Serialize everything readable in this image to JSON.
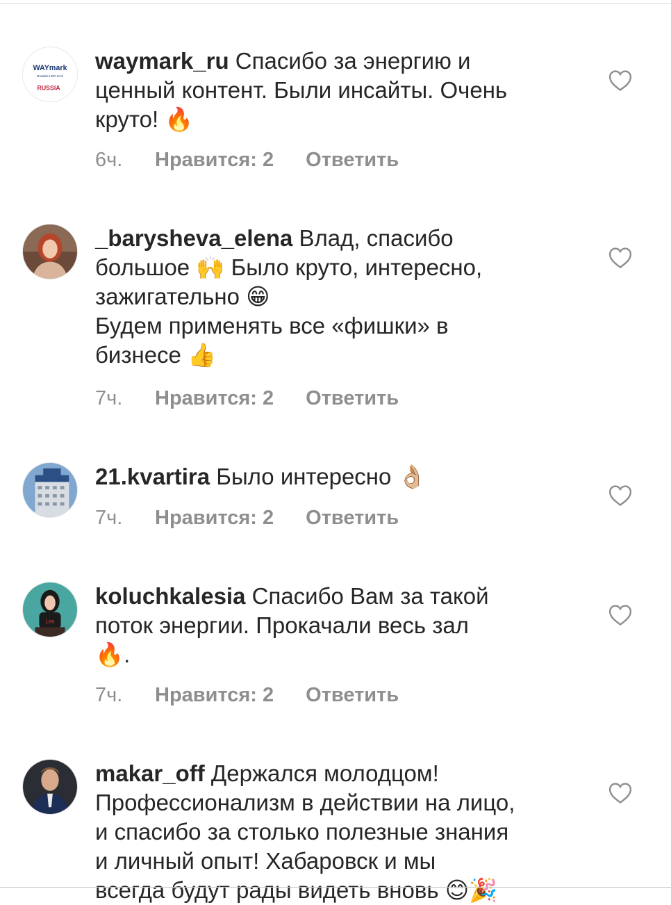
{
  "comments": [
    {
      "username": "waymark_ru",
      "text": " Спасибо за энергию и\nценный контент. Были инсайты. Очень\nкруто! ",
      "emoji": "🔥",
      "time": "6ч.",
      "likes": "Нравится: 2",
      "reply": "Ответить",
      "avatar_logo": "WAYmark",
      "avatar_sub": "Durable LED tech",
      "avatar_country": "RUSSIA"
    },
    {
      "username": "_barysheva_elena",
      "text": " Влад, спасибо\nбольшое 🙌 Было круто, интересно,\nзажигательно 😁\nБудем применять все «фишки» в\nбизнесе 👍",
      "time": "7ч.",
      "likes": "Нравится: 2",
      "reply": "Ответить"
    },
    {
      "username": "21.kvartira",
      "text": " Было интересно 👌🏼",
      "time": "7ч.",
      "likes": "Нравится: 2",
      "reply": "Ответить"
    },
    {
      "username": "koluchkalesia",
      "text": " Спасибо Вам за такой\nпоток энергии. Прокачали весь зал\n🔥.",
      "time": "7ч.",
      "likes": "Нравится: 2",
      "reply": "Ответить"
    },
    {
      "username": "makar_off",
      "text": " Держался молодцом!\nПрофессионализм в действии на лицо,\nи спасибо за столько полезные знания\nи личный опыт! Хабаровск и мы\nвсегда будут рады видеть вновь 😊🎉"
    }
  ],
  "colors": {
    "text": "#262626",
    "secondary": "#8e8e8e",
    "divider": "#dbdbdb"
  },
  "icons": {
    "like": "heart-outline-icon"
  }
}
